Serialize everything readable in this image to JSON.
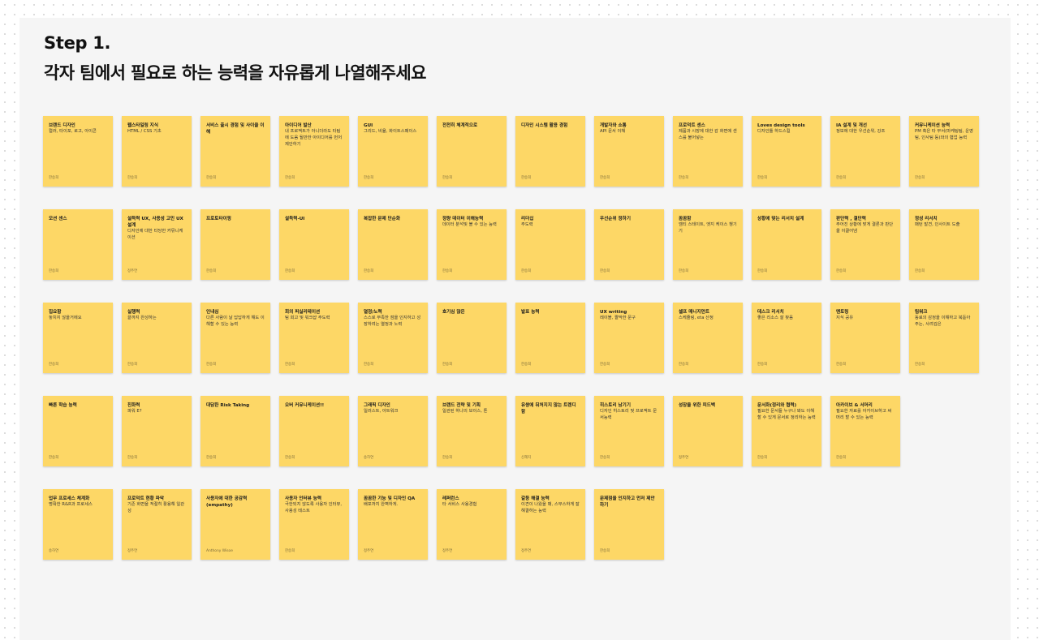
{
  "header": {
    "step": "Step 1.",
    "heading": "각자 팀에서 필요로 하는 능력을 자유롭게 나열해주세요"
  },
  "rows": [
    [
      {
        "title": "브랜드 디자인",
        "body": "컬러, 타이포, 로고, 아이콘",
        "author": "한승희"
      },
      {
        "title": "웹스타일링 지식",
        "body": "HTML / CSS 기초",
        "author": "한승희"
      },
      {
        "title": "서비스 출시 경험 및 사이클 이해",
        "body": "",
        "author": "한승희"
      },
      {
        "title": "아이디어 발산",
        "body": "내 프로젝트가 아니더라도 타팀에 도움 될만한 아이디어를 먼저 제안하기",
        "author": "한승희"
      },
      {
        "title": "GUI",
        "body": "그리드, 비율, 화이트스페이스",
        "author": "한승희"
      },
      {
        "title": "전천히 체계적으로",
        "body": "",
        "author": "한승희"
      },
      {
        "title": "디자인 시스템 활용 경험",
        "body": "",
        "author": "한승희"
      },
      {
        "title": "개발자와 소통",
        "body": "API 문서 이해",
        "author": "한승희"
      },
      {
        "title": "프로덕트 센스",
        "body": "제품과 시장에 대한 감 화면에 센스를 불어넣는",
        "author": "한승희"
      },
      {
        "title": "Loves design tools",
        "body": "디자인툴 하드스킬",
        "author": "한승희"
      },
      {
        "title": "IA 설계 및 개선",
        "body": "정보에 대한 우선순위, 강조",
        "author": "한승희"
      },
      {
        "title": "커뮤니케이션 능력",
        "body": "PM 혹은 타 부서(마케팅팀, 운영팀, 인사팀 등)와의 협업 능력",
        "author": "한승희"
      }
    ],
    [
      {
        "title": "모션 센스",
        "body": "",
        "author": "한승희"
      },
      {
        "title": "설득력 UX, 사용성 고민 UX 설계",
        "body": "디자인에 대한 타당한 커뮤니케이션",
        "author": "정주연"
      },
      {
        "title": "프로토타이핑",
        "body": "",
        "author": "한승희"
      },
      {
        "title": "설득력-UI",
        "body": "",
        "author": "한승희"
      },
      {
        "title": "복잡한 문제 단순화",
        "body": "",
        "author": "한승희"
      },
      {
        "title": "정량 데이터 이해능력",
        "body": "데이터 분석및 볼 수 있는 능력",
        "author": "한승희"
      },
      {
        "title": "리더십",
        "body": "주도력",
        "author": "한승희"
      },
      {
        "title": "우선순위 정하기",
        "body": "",
        "author": "한승희"
      },
      {
        "title": "꼼꼼함",
        "body": "엠티 스테이트, 엣지 케이스 챙기기",
        "author": "한승희"
      },
      {
        "title": "상황에 맞는 리서치 설계",
        "body": "",
        "author": "한승희"
      },
      {
        "title": "판단력 , 결단력",
        "body": "주어진 상황에 맞게 결론과 판단을 이끌어냄",
        "author": "한승희"
      },
      {
        "title": "정성 리서치",
        "body": "패턴 발견, 인사이트 도출",
        "author": "한승희"
      }
    ],
    [
      {
        "title": "집요함",
        "body": "놓치지 않을거에요",
        "author": "한승희"
      },
      {
        "title": "실행력",
        "body": "끝까지 완성하는",
        "author": "한승희"
      },
      {
        "title": "인내심",
        "body": "다른 사람이 날 답답하게 해도 이해할 수 있는 능력",
        "author": "한승희"
      },
      {
        "title": "회의 퍼실리테이션",
        "body": "팀 회고 및 워크샵 주도력",
        "author": "한승희"
      },
      {
        "title": "열정/노력",
        "body": "스스로 부족한 점을 인지하고 성장하려는 열정과 노력",
        "author": "한승희"
      },
      {
        "title": "호기심 많은",
        "body": "",
        "author": "한승희"
      },
      {
        "title": "발표 능력",
        "body": "",
        "author": "한승희"
      },
      {
        "title": "UX writing",
        "body": "레이블, 짤막한 문구",
        "author": "한승희"
      },
      {
        "title": "셀프 매니지먼트",
        "body": "스케쥴링, eta 산정",
        "author": "한승희"
      },
      {
        "title": "데스크 리서치",
        "body": "좋은 리소스 잘 찾음",
        "author": "한승희"
      },
      {
        "title": "멘토링",
        "body": "지식 공유",
        "author": "한승희"
      },
      {
        "title": "팀워크",
        "body": "동료의 감정을 이해하고 북돋아주는, 사려깊은",
        "author": "한승희"
      }
    ],
    [
      {
        "title": "빠른 학습 능력",
        "body": "",
        "author": "한승희"
      },
      {
        "title": "친화력",
        "body": "파워 E?",
        "author": "한승희"
      },
      {
        "title": "대담한 Risk Taking",
        "body": "",
        "author": "한승희"
      },
      {
        "title": "오버 커뮤니케이션!!",
        "body": "",
        "author": "한승희"
      },
      {
        "title": "그래픽 디자인",
        "body": "일러스트, 아트워크",
        "author": "송하연"
      },
      {
        "title": "브랜드 전략 및 기획",
        "body": "일관된 하나의 보이스, 톤",
        "author": "한승희"
      },
      {
        "title": "유쌍에 뒤처지지 않는 트렌디함",
        "body": "",
        "author": "신혜지"
      },
      {
        "title": "히스토리 남기기",
        "body": "디자인 히스토리 및 프로젝트 문서능력",
        "author": "한승희"
      },
      {
        "title": "성장을 위한 피드백",
        "body": "",
        "author": "정주연"
      },
      {
        "title": "문서화(정리와 협력)",
        "body": "필요한 문서들 누구나 봐도 이해할 수 있게 문서로 정리하는 능력",
        "author": "한승희"
      },
      {
        "title": "아카이브 & 서머리",
        "body": "필요한 자료를 아카이브하고 써머리 할 수 있는 능력",
        "author": "한승희"
      }
    ],
    [
      {
        "title": "업무 프로세스 체계화",
        "body": "명확한 R&R과 프로세스",
        "author": "송하연"
      },
      {
        "title": "프로덕트 현황 파악",
        "body": "기존 화면을 적절히 활용해 일관성",
        "author": "정주연"
      },
      {
        "title": "사용자에 대한 공감력 (empathy)",
        "body": "",
        "author": "Anthony Wisoe"
      },
      {
        "title": "사용자 인터뷰 능력",
        "body": "극한되지 않도록 사용자 인터뷰, 사용성 테스트",
        "author": "한승희"
      },
      {
        "title": "꼼꼼한 기능 및 디자인 QA",
        "body": "배포까지 완벽하게.",
        "author": "정주연"
      },
      {
        "title": "레퍼런스",
        "body": "타 서비스 사용경험",
        "author": "정주연"
      },
      {
        "title": "갈등 해결 능력",
        "body": "이견이 나왔을 때, 스무스하게 잘 해결하는 능력",
        "author": "정주연"
      },
      {
        "title": "문제점을 인지하고 먼저 제안하기",
        "body": "",
        "author": "한승희"
      }
    ]
  ]
}
